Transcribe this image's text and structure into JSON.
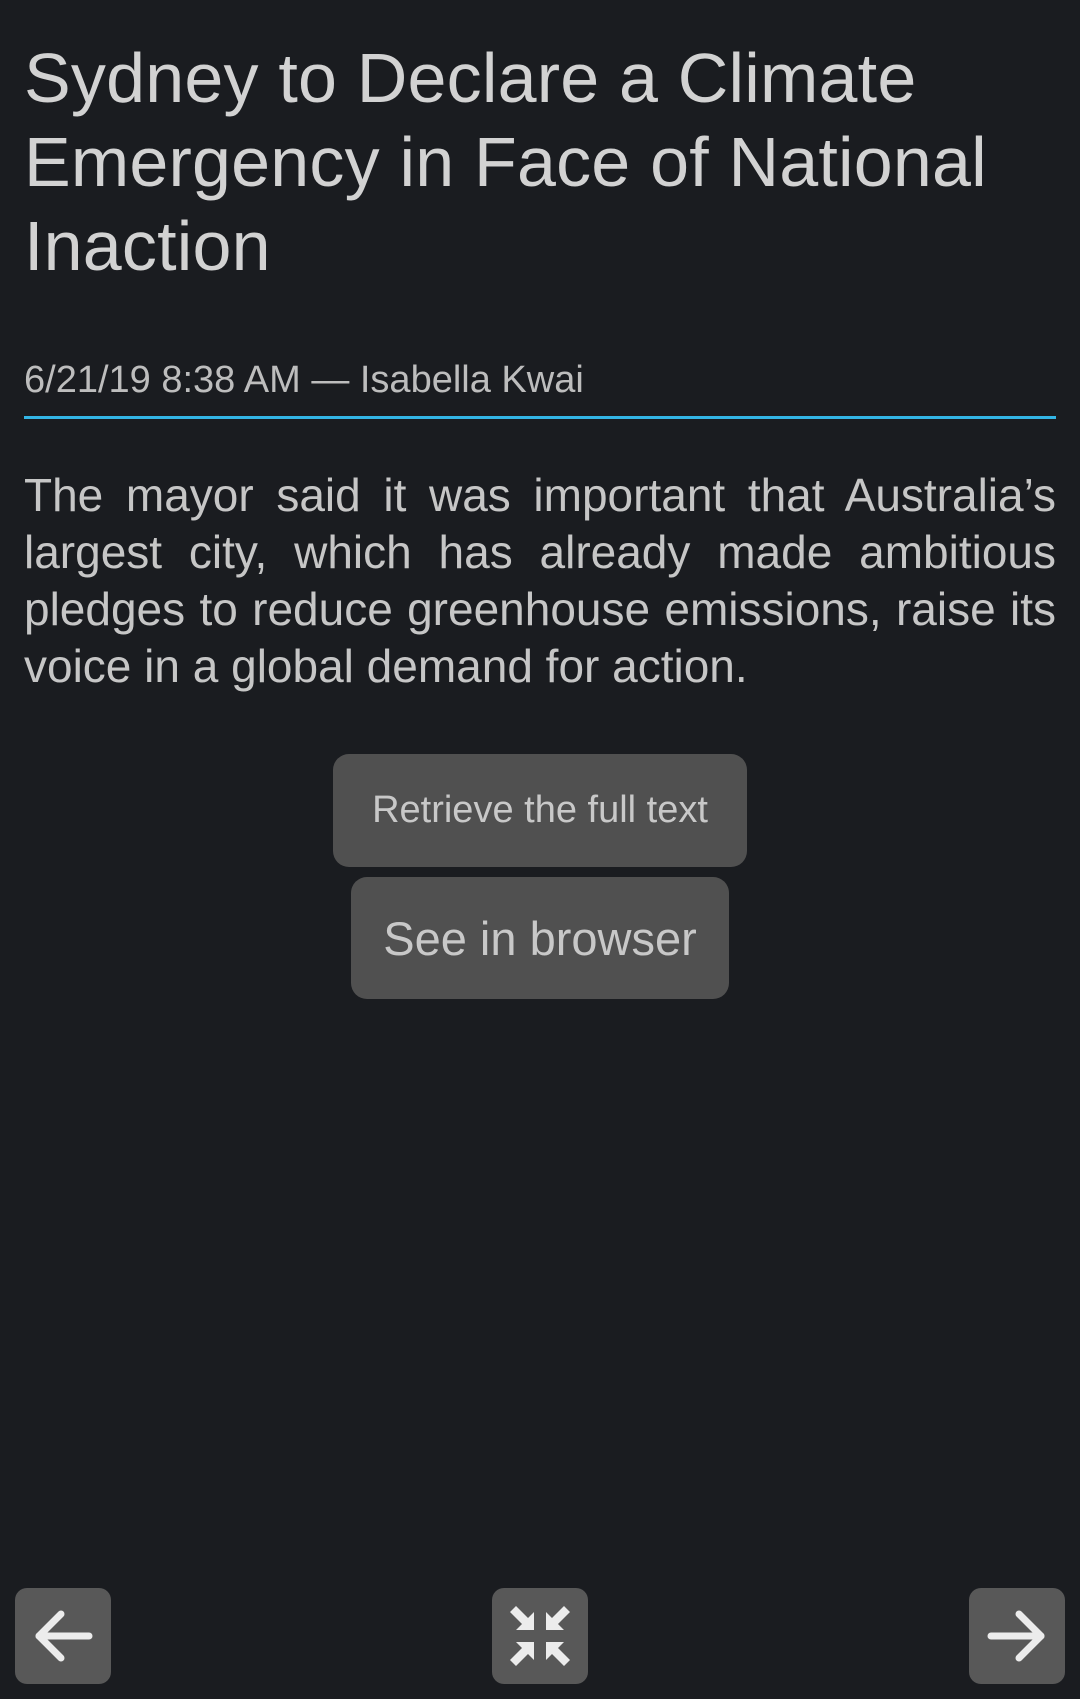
{
  "article": {
    "title": "Sydney to Declare a Climate Emergency in Face of National Inaction",
    "meta": "6/21/19 8:38 AM — Isabella Kwai",
    "summary": "The mayor said it was important that Australia’s largest city, which has already made ambitious pledges to reduce greenhouse emissions, raise its voice in a global demand for action."
  },
  "actions": {
    "retrieve_label": "Retrieve the full text",
    "browser_label": "See in browser"
  },
  "navigation": {
    "prev_icon": "arrow-left-icon",
    "collapse_icon": "collapse-icon",
    "next_icon": "arrow-right-icon"
  },
  "colors": {
    "background": "#1a1c20",
    "accent": "#33b5e5",
    "button": "#505050"
  }
}
